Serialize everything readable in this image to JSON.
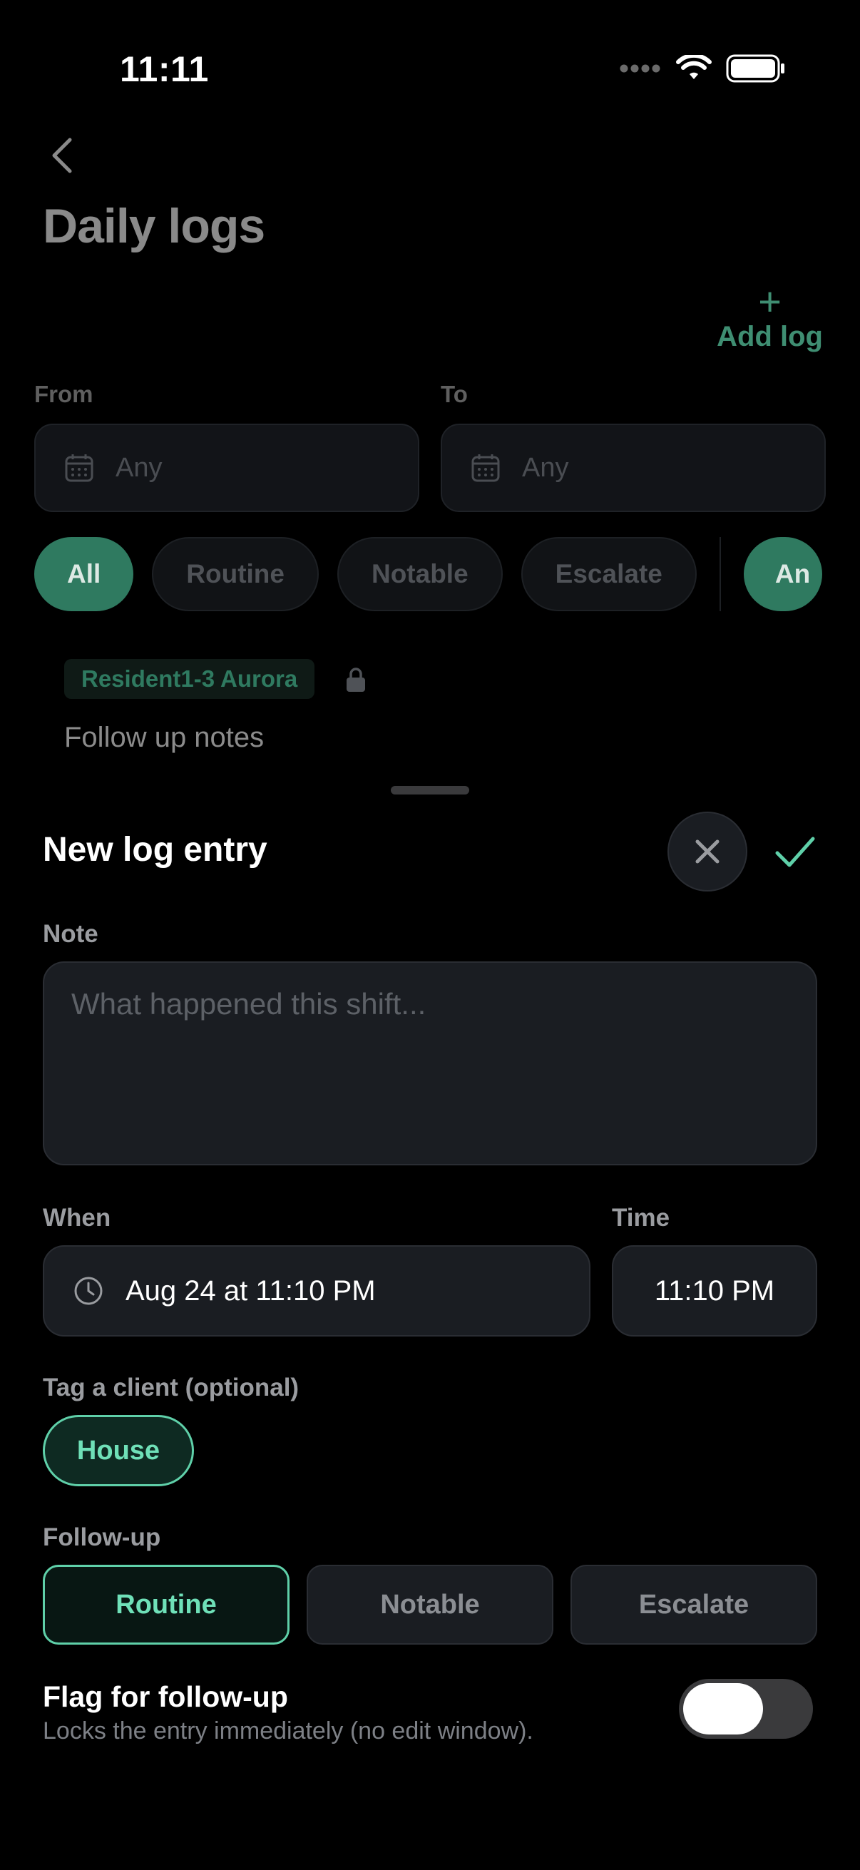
{
  "status_bar": {
    "time": "11:11"
  },
  "page": {
    "title": "Daily logs",
    "add_log_label": "Add log",
    "add_log_glyph": "+",
    "from_label": "From",
    "to_label": "To",
    "from_placeholder": "Any",
    "to_placeholder": "Any",
    "filters": [
      "All",
      "Routine",
      "Notable",
      "Escalate"
    ],
    "filter_overflow": "An",
    "entry": {
      "client": "Resident1-3 Aurora",
      "text": "Follow up notes"
    }
  },
  "sheet": {
    "title": "New log entry",
    "note_label": "Note",
    "note_placeholder": "What happened this shift...",
    "when_label": "When",
    "when_value": "Aug 24 at 11:10 PM",
    "time_label": "Time",
    "time_value": "11:10 PM",
    "tag_label": "Tag a client (optional)",
    "tag_chip": "House",
    "followup_label": "Follow-up",
    "followup_options": [
      "Routine",
      "Notable",
      "Escalate"
    ],
    "followup_selected": "Routine",
    "flag_title": "Flag for follow-up",
    "flag_subtitle": "Locks the entry immediately (no edit window).",
    "flag_on": false
  },
  "colors": {
    "accent": "#5fd0a9",
    "accent_dim": "#2f7a60",
    "background": "#000000",
    "field": "#1a1d22"
  }
}
